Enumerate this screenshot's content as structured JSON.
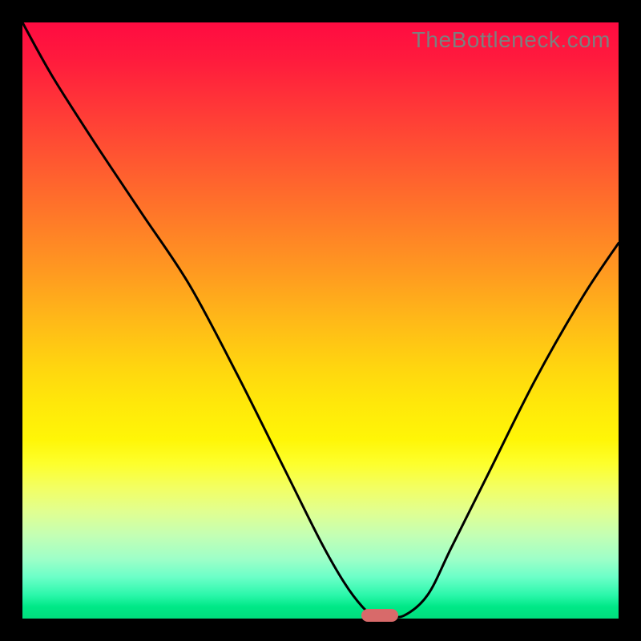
{
  "watermark": "TheBottleneck.com",
  "colors": {
    "frame": "#000000",
    "line": "#000000",
    "marker": "#d86a6a"
  },
  "chart_data": {
    "type": "line",
    "title": "",
    "xlabel": "",
    "ylabel": "",
    "xlim": [
      0,
      100
    ],
    "ylim": [
      0,
      100
    ],
    "grid": false,
    "x": [
      0,
      5,
      12,
      20,
      28,
      36,
      44,
      50,
      54,
      57,
      59,
      61,
      64,
      68,
      72,
      78,
      86,
      94,
      100
    ],
    "values": [
      100,
      91,
      80,
      68,
      56,
      41,
      25,
      13,
      6,
      2,
      0.5,
      0.5,
      0.5,
      4,
      12,
      24,
      40,
      54,
      63
    ],
    "marker": {
      "x": 60,
      "y": 0.5
    },
    "background_gradient": {
      "direction": "vertical",
      "stops": [
        {
          "pos": 0,
          "color": "#ff0b41"
        },
        {
          "pos": 50,
          "color": "#ffb918"
        },
        {
          "pos": 74,
          "color": "#fdff2c"
        },
        {
          "pos": 90,
          "color": "#6cffc8"
        },
        {
          "pos": 100,
          "color": "#00de7d"
        }
      ]
    }
  }
}
